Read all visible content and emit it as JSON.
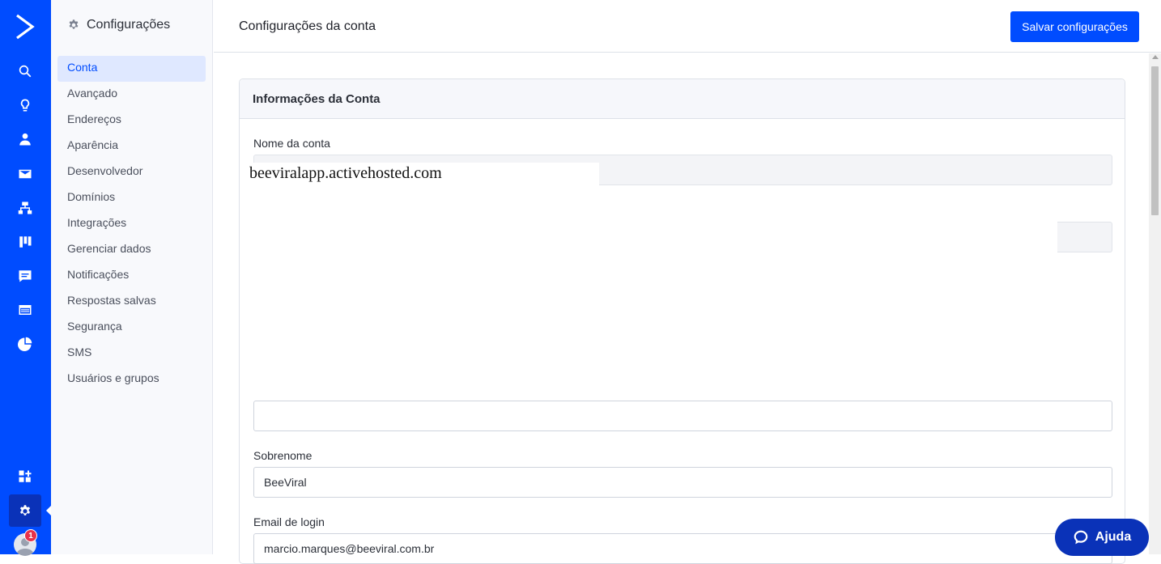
{
  "rail": {
    "icons": [
      "logo-icon",
      "search-icon",
      "lightbulb-icon",
      "contacts-icon",
      "email-icon",
      "automations-icon",
      "deals-pipeline-icon",
      "conversations-icon",
      "site-icon",
      "reports-icon",
      "apps-icon",
      "settings-icon"
    ],
    "notification_count": "1"
  },
  "sidebar": {
    "title": "Configurações",
    "items": [
      {
        "label": "Conta",
        "active": true
      },
      {
        "label": "Avançado"
      },
      {
        "label": "Endereços"
      },
      {
        "label": "Aparência"
      },
      {
        "label": "Desenvolvedor"
      },
      {
        "label": "Domínios"
      },
      {
        "label": "Integrações"
      },
      {
        "label": "Gerenciar dados"
      },
      {
        "label": "Notificações"
      },
      {
        "label": "Respostas salvas"
      },
      {
        "label": "Segurança"
      },
      {
        "label": "SMS"
      },
      {
        "label": "Usuários e grupos"
      }
    ]
  },
  "header": {
    "title": "Configurações da conta",
    "save_label": "Salvar configurações"
  },
  "card": {
    "title": "Informações da Conta",
    "account_name_label": "Nome da conta",
    "account_name_value": "beeviralapp.activehosted.com",
    "lastname_label": "Sobrenome",
    "lastname_value": "BeeViral",
    "email_label": "Email de login",
    "email_value": "marcio.marques@beeviral.com.br"
  },
  "help": {
    "label": "Ajuda"
  },
  "colors": {
    "brand": "#004cff",
    "brand_dark": "#0a32b8",
    "badge": "#e8324a"
  }
}
